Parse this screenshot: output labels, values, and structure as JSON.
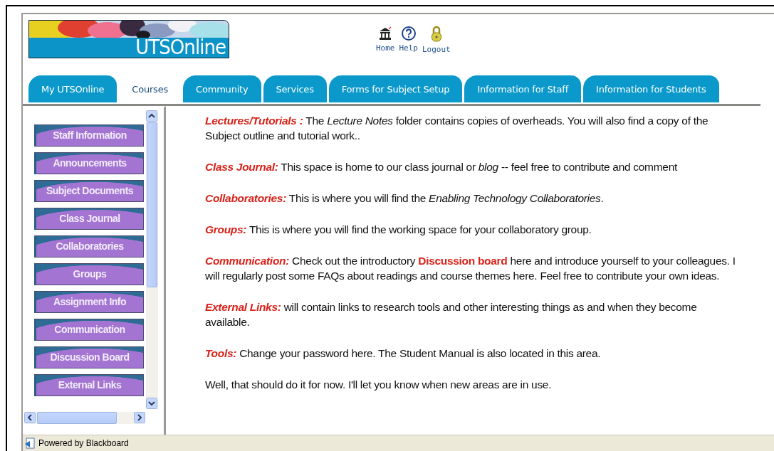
{
  "header": {
    "logo_text": "UTSOnline",
    "links": [
      {
        "kind": "home",
        "label": "Home"
      },
      {
        "kind": "help",
        "label": "Help"
      },
      {
        "kind": "logout",
        "label": "Logout"
      }
    ]
  },
  "tabs": [
    {
      "label": "My UTSOnline",
      "selected": false
    },
    {
      "label": "Courses",
      "selected": true
    },
    {
      "label": "Community",
      "selected": false
    },
    {
      "label": "Services",
      "selected": false
    },
    {
      "label": "Forms for Subject Setup",
      "selected": false
    },
    {
      "label": "Information for Staff",
      "selected": false
    },
    {
      "label": "Information for Students",
      "selected": false
    }
  ],
  "sidebar": {
    "items": [
      "Staff Information",
      "Announcements",
      "Subject Documents",
      "Class Journal",
      "Collaboratories",
      "Groups",
      "Assignment Info",
      "Communication",
      "Discussion Board",
      "External Links"
    ]
  },
  "content": {
    "paragraphs": [
      {
        "heading": "Lectures/Tutorials :",
        "text": "The *Lecture Notes* folder contains copies of overheads. You will also find a copy of the Subject outline and tutorial work.."
      },
      {
        "heading": "Class Journal:",
        "text": "This space is home to our class journal or *blog* -- feel free to contribute and comment"
      },
      {
        "heading": "Collaboratories:",
        "text": " This is where you will find the *Enabling Technology Collaboratories*."
      },
      {
        "heading": "Groups:",
        "text": " This is where you will find the working space for your collaboratory group."
      },
      {
        "heading": "Communication:",
        "text": "Check out the introductory **Discussion board** here and introduce yourself to your colleagues. I will regularly post some FAQs about readings and course themes here. Feel free to contribute your own ideas."
      },
      {
        "heading": "External Links:",
        "text": "will contain links to research tools and other interesting things as and when they become available."
      },
      {
        "heading": "Tools:",
        "text": "Change your password here. The Student Manual is also located in this area."
      },
      {
        "text": "Well, that should do it for now. I'll let you know when new areas are in use."
      }
    ]
  },
  "status_bar": {
    "text": "Powered by Blackboard"
  }
}
